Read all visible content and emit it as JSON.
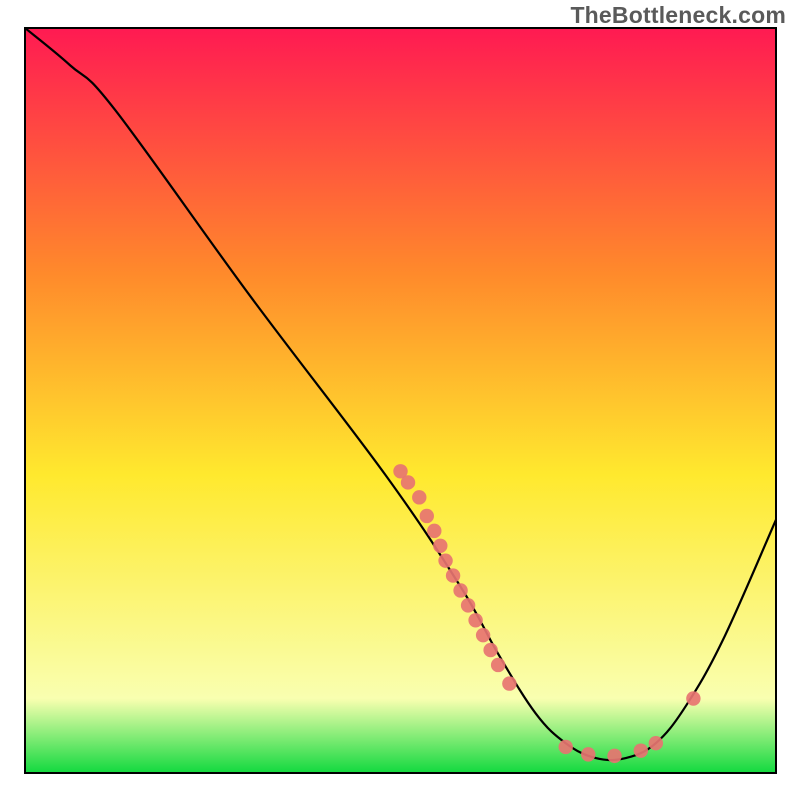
{
  "watermark": "TheBottleneck.com",
  "chart_data": {
    "type": "line",
    "title": "",
    "xlabel": "",
    "ylabel": "",
    "xlim": [
      0,
      100
    ],
    "ylim": [
      0,
      100
    ],
    "grid": false,
    "curve": [
      {
        "x": 0,
        "y": 100
      },
      {
        "x": 6,
        "y": 95
      },
      {
        "x": 12,
        "y": 89
      },
      {
        "x": 30,
        "y": 64
      },
      {
        "x": 48,
        "y": 40
      },
      {
        "x": 58,
        "y": 25
      },
      {
        "x": 63,
        "y": 16
      },
      {
        "x": 68,
        "y": 8
      },
      {
        "x": 72,
        "y": 4
      },
      {
        "x": 76,
        "y": 2
      },
      {
        "x": 80,
        "y": 2
      },
      {
        "x": 84,
        "y": 4
      },
      {
        "x": 88,
        "y": 9
      },
      {
        "x": 93,
        "y": 18
      },
      {
        "x": 100,
        "y": 34
      }
    ],
    "markers": [
      {
        "x": 50,
        "y": 40.5
      },
      {
        "x": 51,
        "y": 39
      },
      {
        "x": 52.5,
        "y": 37
      },
      {
        "x": 53.5,
        "y": 34.5
      },
      {
        "x": 54.5,
        "y": 32.5
      },
      {
        "x": 55.3,
        "y": 30.5
      },
      {
        "x": 56,
        "y": 28.5
      },
      {
        "x": 57,
        "y": 26.5
      },
      {
        "x": 58,
        "y": 24.5
      },
      {
        "x": 59,
        "y": 22.5
      },
      {
        "x": 60,
        "y": 20.5
      },
      {
        "x": 61,
        "y": 18.5
      },
      {
        "x": 62,
        "y": 16.5
      },
      {
        "x": 63,
        "y": 14.5
      },
      {
        "x": 64.5,
        "y": 12
      },
      {
        "x": 72,
        "y": 3.5
      },
      {
        "x": 75,
        "y": 2.5
      },
      {
        "x": 78.5,
        "y": 2.3
      },
      {
        "x": 82,
        "y": 3
      },
      {
        "x": 84,
        "y": 4
      },
      {
        "x": 89,
        "y": 10
      }
    ],
    "colors": {
      "gradient_top": "#ff1a52",
      "gradient_upper_mid": "#ff8a2b",
      "gradient_mid": "#ffe92e",
      "gradient_lower": "#f9ffb0",
      "gradient_bottom": "#12d93f",
      "curve": "#000000",
      "marker_fill": "#e77471",
      "frame": "#000000"
    }
  }
}
